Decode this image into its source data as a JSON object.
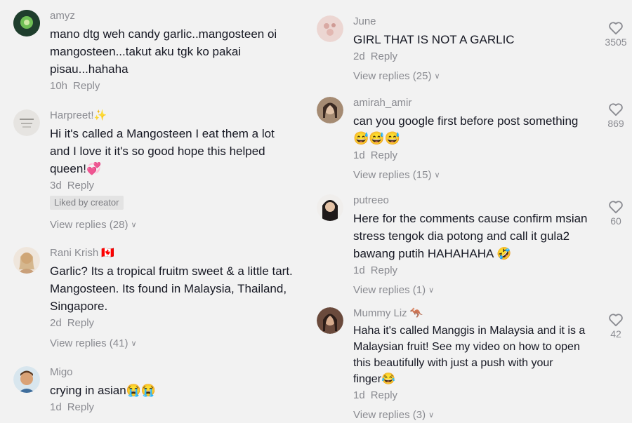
{
  "left": [
    {
      "user": "amyz",
      "user_suffix": "",
      "lines": [
        "mano dtg weh candy garlic..mangosteen oi",
        "mangosteen...takut aku tgk ko pakai",
        "pisau...hahaha"
      ],
      "time": "10h",
      "reply": "Reply",
      "avatar_color": "#2f4f3a"
    },
    {
      "user": "Harpreet!",
      "user_suffix": "✨",
      "lines": [
        "Hi it's called a Mangosteen I eat them a lot",
        "and I love it it's so good hope this helped",
        "queen!💞"
      ],
      "time": "3d",
      "reply": "Reply",
      "badge": "Liked by creator",
      "view_replies": "View replies (28)",
      "avatar_color": "#e4e2df"
    },
    {
      "user": "Rani Krish",
      "user_suffix": "🇨🇦",
      "lines": [
        "Garlic? Its a tropical fruitm sweet & a little tart.",
        "Mangosteen. Its found in Malaysia, Thailand,",
        "Singapore."
      ],
      "time": "2d",
      "reply": "Reply",
      "view_replies": "View replies (41)",
      "avatar_color": "#d8b89a"
    },
    {
      "user": "Migo",
      "user_suffix": "",
      "lines": [
        "crying in asian😭😭"
      ],
      "time": "1d",
      "reply": "Reply",
      "avatar_color": "#c79870"
    }
  ],
  "right": [
    {
      "user": "June",
      "lines": [
        "GIRL THAT IS NOT A GARLIC"
      ],
      "time": "2d",
      "reply": "Reply",
      "view_replies": "View replies (25)",
      "likes": "3505",
      "avatar_color": "#e8d3d0"
    },
    {
      "user": "amirah_amir",
      "lines": [
        "can you google first before post something",
        "😅😅😅"
      ],
      "time": "1d",
      "reply": "Reply",
      "view_replies": "View replies (15)",
      "likes": "869",
      "avatar_color": "#b79a82"
    },
    {
      "user": "putreeo",
      "lines": [
        "Here for the comments cause confirm msian",
        "stress tengok dia potong and call it gula2",
        "bawang putih HAHAHAHA 🤣"
      ],
      "time": "1d",
      "reply": "Reply",
      "view_replies": "View replies (1)",
      "likes": "60",
      "avatar_color": "#3a2f2c"
    },
    {
      "user": "Mummy Liz",
      "user_suffix": "🦘",
      "lines": [
        "Haha it's called Manggis in Malaysia and it is a",
        "Malaysian fruit! See my video on how to open",
        "this beautifully with just a push with your",
        "finger😂"
      ],
      "time": "1d",
      "reply": "Reply",
      "view_replies": "View replies (3)",
      "likes": "42",
      "avatar_color": "#6b4a3a"
    }
  ]
}
